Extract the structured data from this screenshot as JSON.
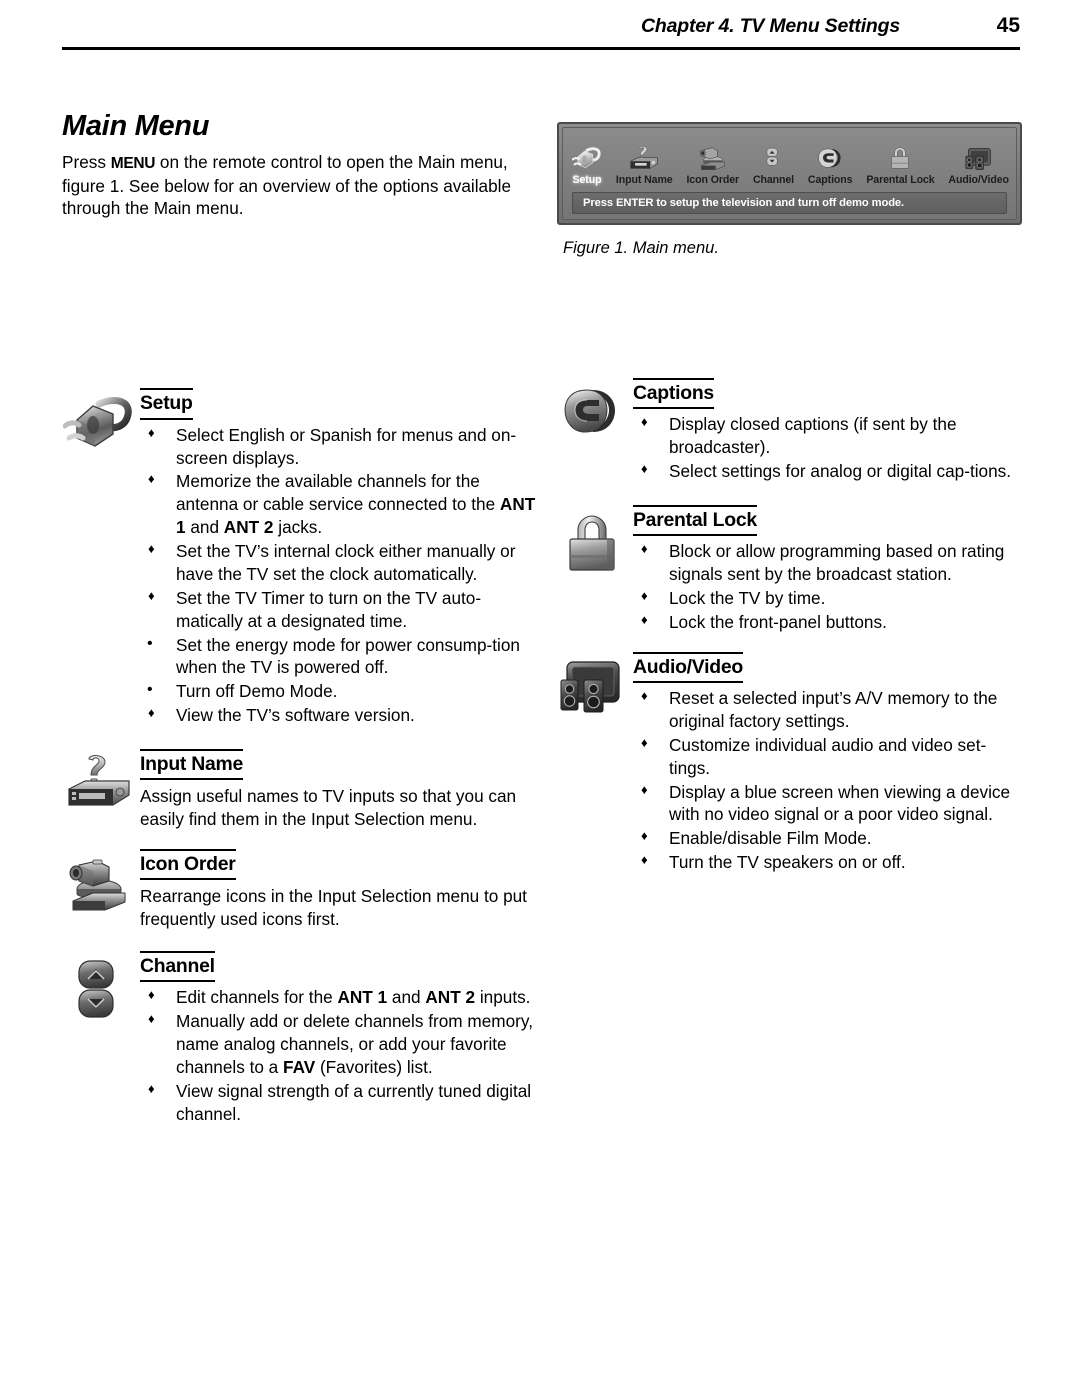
{
  "header": {
    "chapter": "Chapter 4. TV Menu Settings",
    "page_number": "45"
  },
  "intro": {
    "title": "Main Menu",
    "text_before_key": "Press ",
    "key": "MENU",
    "text_after_key": " on the remote control to open the Main menu, figure 1.  See below for an overview of the options available through the Main menu."
  },
  "figure": {
    "caption": "Figure 1.  Main menu.",
    "status_text": "Press ENTER to setup the television and turn off demo mode.",
    "items": [
      {
        "label": "Setup",
        "icon": "power-plug-icon",
        "selected": true
      },
      {
        "label": "Input Name",
        "icon": "input-name-icon",
        "selected": false
      },
      {
        "label": "Icon Order",
        "icon": "camcorder-icon",
        "selected": false
      },
      {
        "label": "Channel",
        "icon": "channel-updown-icon",
        "selected": false
      },
      {
        "label": "Captions",
        "icon": "captions-cc-icon",
        "selected": false
      },
      {
        "label": "Parental Lock",
        "icon": "padlock-icon",
        "selected": false
      },
      {
        "label": "Audio/Video",
        "icon": "tv-speakers-icon",
        "selected": false
      }
    ]
  },
  "sections": {
    "setup": {
      "heading": "Setup",
      "icon": "power-plug-icon",
      "bullets": [
        {
          "marker": "diamond",
          "parts": [
            {
              "t": "Select English or Spanish for menus and on-screen displays."
            }
          ]
        },
        {
          "marker": "diamond",
          "parts": [
            {
              "t": "Memorize the available channels for the antenna or cable service connected to the "
            },
            {
              "t": "ANT 1",
              "b": true
            },
            {
              "t": " and "
            },
            {
              "t": "ANT 2",
              "b": true
            },
            {
              "t": " jacks."
            }
          ]
        },
        {
          "marker": "diamond",
          "parts": [
            {
              "t": "Set the TV’s internal clock either manually or have the TV set the clock automatically."
            }
          ]
        },
        {
          "marker": "diamond",
          "parts": [
            {
              "t": "Set the TV Timer to turn on the TV auto-matically at a designated time."
            }
          ]
        },
        {
          "marker": "round",
          "parts": [
            {
              "t": "Set the energy mode for power consump-tion when the TV is powered off."
            }
          ]
        },
        {
          "marker": "round",
          "parts": [
            {
              "t": "Turn off Demo Mode."
            }
          ]
        },
        {
          "marker": "diamond",
          "parts": [
            {
              "t": "View the TV’s software version."
            }
          ]
        }
      ]
    },
    "input_name": {
      "heading": "Input Name",
      "icon": "input-name-icon",
      "paragraph": "Assign useful names to TV inputs so that you can easily find them in the Input Selection menu."
    },
    "icon_order": {
      "heading": "Icon Order",
      "icon": "camcorder-icon",
      "paragraph": "Rearrange icons in the Input Selection menu to put frequently used icons first."
    },
    "channel": {
      "heading": "Channel",
      "icon": "channel-updown-icon",
      "bullets": [
        {
          "marker": "diamond",
          "parts": [
            {
              "t": "Edit channels for the "
            },
            {
              "t": "ANT 1",
              "b": true
            },
            {
              "t": " and "
            },
            {
              "t": "ANT 2",
              "b": true
            },
            {
              "t": " inputs."
            }
          ]
        },
        {
          "marker": "diamond",
          "parts": [
            {
              "t": "Manually add or delete channels from memory, name analog channels, or add your favorite channels to a "
            },
            {
              "t": "FAV",
              "b": true
            },
            {
              "t": " (Favorites) list."
            }
          ]
        },
        {
          "marker": "diamond",
          "parts": [
            {
              "t": "View signal strength of a currently tuned digital channel."
            }
          ]
        }
      ]
    },
    "captions": {
      "heading": "Captions",
      "icon": "captions-cc-icon",
      "bullets": [
        {
          "marker": "diamond",
          "parts": [
            {
              "t": "Display closed captions (if sent by the broadcaster)."
            }
          ]
        },
        {
          "marker": "diamond",
          "parts": [
            {
              "t": "Select settings for analog or digital cap-tions."
            }
          ]
        }
      ]
    },
    "parental_lock": {
      "heading": "Parental Lock",
      "icon": "padlock-icon",
      "bullets": [
        {
          "marker": "diamond",
          "parts": [
            {
              "t": "Block or allow programming based on rating signals sent by the broadcast station."
            }
          ]
        },
        {
          "marker": "diamond",
          "parts": [
            {
              "t": "Lock the TV by time."
            }
          ]
        },
        {
          "marker": "diamond",
          "parts": [
            {
              "t": "Lock the front-panel buttons."
            }
          ]
        }
      ]
    },
    "audio_video": {
      "heading": "Audio/Video",
      "icon": "tv-speakers-icon",
      "bullets": [
        {
          "marker": "diamond",
          "parts": [
            {
              "t": "Reset a selected input’s A/V memory to the original factory settings."
            }
          ]
        },
        {
          "marker": "diamond",
          "parts": [
            {
              "t": "Customize individual audio and video set-tings."
            }
          ]
        },
        {
          "marker": "diamond",
          "parts": [
            {
              "t": "Display a blue screen when viewing a device with no video signal or a poor video signal."
            }
          ]
        },
        {
          "marker": "diamond",
          "parts": [
            {
              "t": "Enable/disable Film Mode."
            }
          ]
        },
        {
          "marker": "diamond",
          "parts": [
            {
              "t": "Turn the TV speakers on or off."
            }
          ]
        }
      ]
    }
  }
}
